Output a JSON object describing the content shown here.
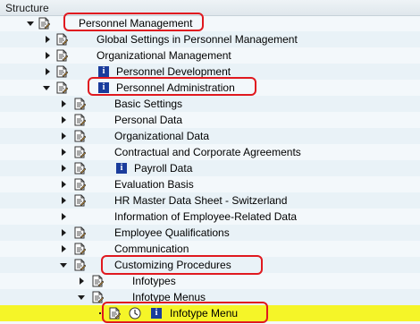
{
  "header": {
    "title": "Structure"
  },
  "tree": [
    {
      "label": "Personnel Management"
    },
    {
      "label": "Global Settings in Personnel Management"
    },
    {
      "label": "Organizational Management"
    },
    {
      "label": "Personnel Development"
    },
    {
      "label": "Personnel Administration"
    },
    {
      "label": "Basic Settings"
    },
    {
      "label": "Personal Data"
    },
    {
      "label": "Organizational Data"
    },
    {
      "label": "Contractual and Corporate Agreements"
    },
    {
      "label": "Payroll Data"
    },
    {
      "label": "Evaluation Basis"
    },
    {
      "label": "HR Master Data Sheet - Switzerland"
    },
    {
      "label": "Information of Employee-Related Data"
    },
    {
      "label": "Employee Qualifications"
    },
    {
      "label": "Communication"
    },
    {
      "label": "Customizing Procedures"
    },
    {
      "label": "Infotypes"
    },
    {
      "label": "Infotype Menus"
    },
    {
      "label": "Infotype Menu"
    }
  ],
  "colors": {
    "highlight": "#e0191f",
    "selected_row": "#f5f528",
    "info_icon": "#1a3c9c"
  }
}
